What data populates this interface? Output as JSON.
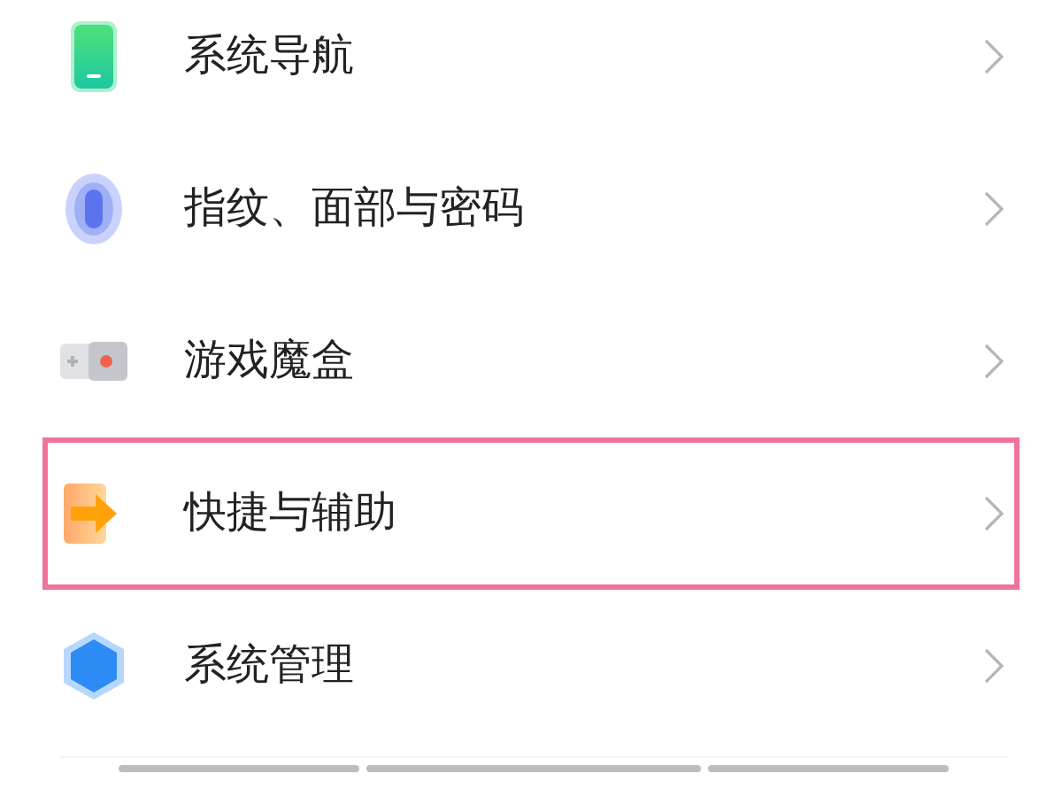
{
  "settings_items": [
    {
      "label": "系统导航",
      "selected": false
    },
    {
      "label": "指纹、面部与密码",
      "selected": false
    },
    {
      "label": "游戏魔盒",
      "selected": false
    },
    {
      "label": "快捷与辅助",
      "selected": true
    },
    {
      "label": "系统管理",
      "selected": false
    }
  ]
}
